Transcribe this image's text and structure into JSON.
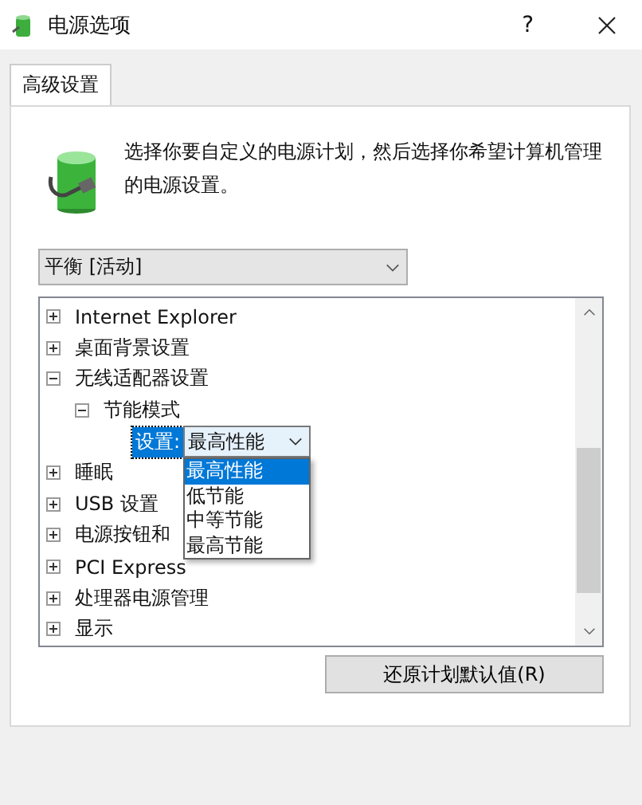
{
  "window": {
    "title": "电源选项",
    "help": "?"
  },
  "tabs": [
    {
      "label": "高级设置",
      "selected": true
    }
  ],
  "description": "选择你要自定义的电源计划，然后选择你希望计算机管理的电源设置。",
  "plan_select": {
    "value": "平衡 [活动]"
  },
  "settings_tree": [
    {
      "label": "Internet Explorer",
      "expanded": false
    },
    {
      "label": "桌面背景设置",
      "expanded": false
    },
    {
      "label": "无线适配器设置",
      "expanded": true,
      "children": [
        {
          "label": "节能模式",
          "expanded": true,
          "setting": {
            "label": "设置:",
            "value": "最高性能",
            "options": [
              {
                "label": "最高性能",
                "selected": true
              },
              {
                "label": "低节能",
                "selected": false
              },
              {
                "label": "中等节能",
                "selected": false
              },
              {
                "label": "最高节能",
                "selected": false
              }
            ]
          }
        }
      ]
    },
    {
      "label": "睡眠",
      "expanded": false
    },
    {
      "label": "USB 设置",
      "expanded": false
    },
    {
      "label": "电源按钮和",
      "expanded": false
    },
    {
      "label": "PCI Express",
      "expanded": false
    },
    {
      "label": "处理器电源管理",
      "expanded": false
    },
    {
      "label": "显示",
      "expanded": false
    }
  ],
  "restore_button": "还原计划默认值(R)"
}
